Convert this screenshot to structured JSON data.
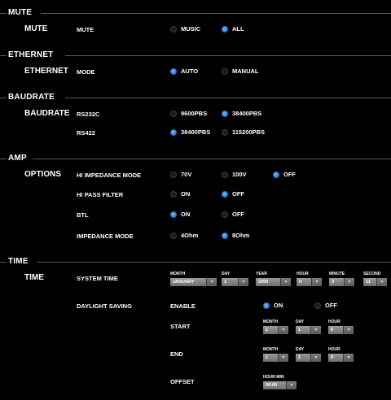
{
  "sections": {
    "mute": {
      "title": "MUTE",
      "category": "MUTE",
      "label": "MUTE",
      "options": [
        "MUSIC",
        "ALL"
      ]
    },
    "ethernet": {
      "title": "ETHERNET",
      "category": "ETHERNET",
      "label": "MODE",
      "options": [
        "AUTO",
        "MANUAL"
      ]
    },
    "baudrate": {
      "title": "BAUDRATE",
      "category": "BAUDRATE",
      "rs232c": {
        "label": "RS232C",
        "options": [
          "9600PBS",
          "38400PBS"
        ]
      },
      "rs422": {
        "label": "RS422",
        "options": [
          "38400PBS",
          "115200PBS"
        ]
      }
    },
    "amp": {
      "title": "AMP",
      "category": "OPTIONS",
      "hi_impedance": {
        "label": "HI IMPEDANCE MODE",
        "options": [
          "70V",
          "100V",
          "OFF"
        ]
      },
      "hi_pass": {
        "label": "HI PASS FILTER",
        "options": [
          "ON",
          "OFF"
        ]
      },
      "btl": {
        "label": "BTL",
        "options": [
          "ON",
          "OFF"
        ]
      },
      "impedance": {
        "label": "IMPEDANCE MODE",
        "options": [
          "4Ohm",
          "8Ohm"
        ]
      }
    },
    "time": {
      "title": "TIME",
      "category": "TIME",
      "system_time": {
        "label": "SYSTEM TIME",
        "fields": [
          {
            "name": "MONTH",
            "value": "JANUARY"
          },
          {
            "name": "DAY",
            "value": "1"
          },
          {
            "name": "YEAR",
            "value": "2000"
          },
          {
            "name": "HOUR",
            "value": "0"
          },
          {
            "name": "MINUTE",
            "value": "3"
          },
          {
            "name": "SECOND",
            "value": "11"
          }
        ]
      },
      "daylight": {
        "label": "DAYLIGHT SAVING",
        "enable_label": "ENABLE",
        "options": [
          "ON",
          "OFF"
        ]
      },
      "start": {
        "label": "START",
        "fields": [
          {
            "name": "MONTH",
            "value": "1"
          },
          {
            "name": "DAY",
            "value": "1"
          },
          {
            "name": "HOUR",
            "value": "0"
          }
        ]
      },
      "end": {
        "label": "END",
        "fields": [
          {
            "name": "MONTH",
            "value": "1"
          },
          {
            "name": "DAY",
            "value": "1"
          },
          {
            "name": "HOUR",
            "value": "0"
          }
        ]
      },
      "offset": {
        "label": "OFFSET",
        "field": {
          "name": "HOUR:MIN",
          "value": "00:00"
        }
      }
    }
  },
  "arrow_glyph": "▼",
  "accent_color": "#2a7fd8"
}
